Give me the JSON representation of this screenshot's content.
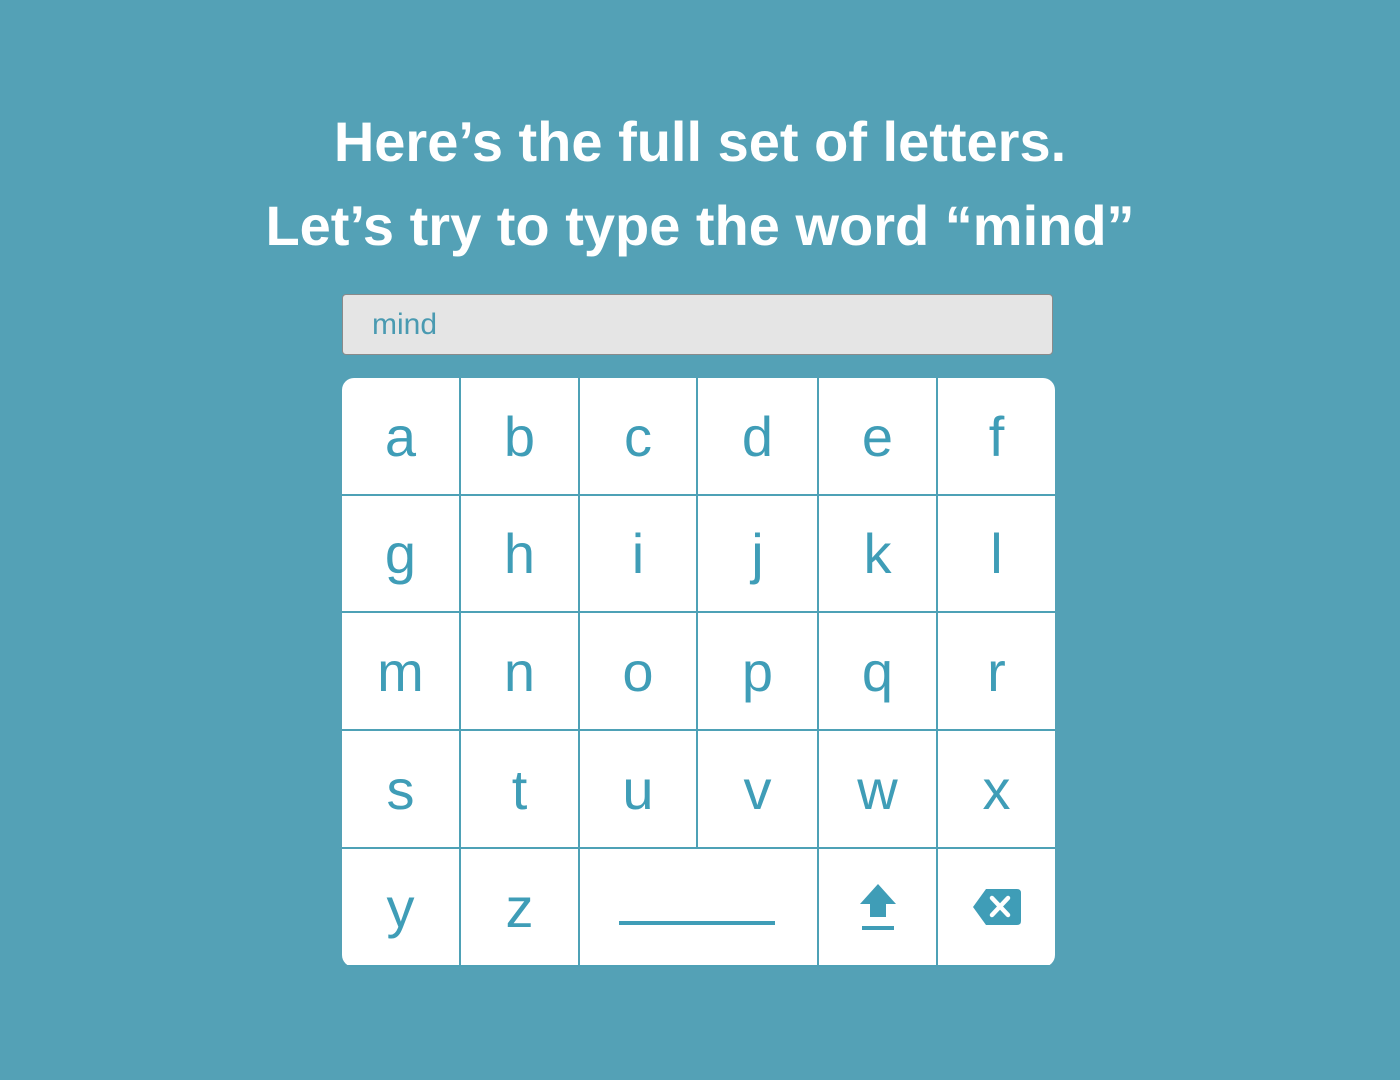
{
  "instructions": {
    "line1": "Here’s the full set of letters.",
    "line2": "Let’s try to type the word “mind”"
  },
  "text_field": {
    "value": "mind"
  },
  "keyboard": {
    "keys": [
      "a",
      "b",
      "c",
      "d",
      "e",
      "f",
      "g",
      "h",
      "i",
      "j",
      "k",
      "l",
      "m",
      "n",
      "o",
      "p",
      "q",
      "r",
      "s",
      "t",
      "u",
      "v",
      "w",
      "x",
      "y",
      "z"
    ],
    "space_icon": "space-bar-icon",
    "shift_icon": "shift-arrow-icon",
    "backspace_icon": "backspace-icon"
  },
  "colors": {
    "background": "#54a1b6",
    "key_text": "#3f9db7",
    "key_face": "#ffffff",
    "field": "#e5e5e5"
  }
}
